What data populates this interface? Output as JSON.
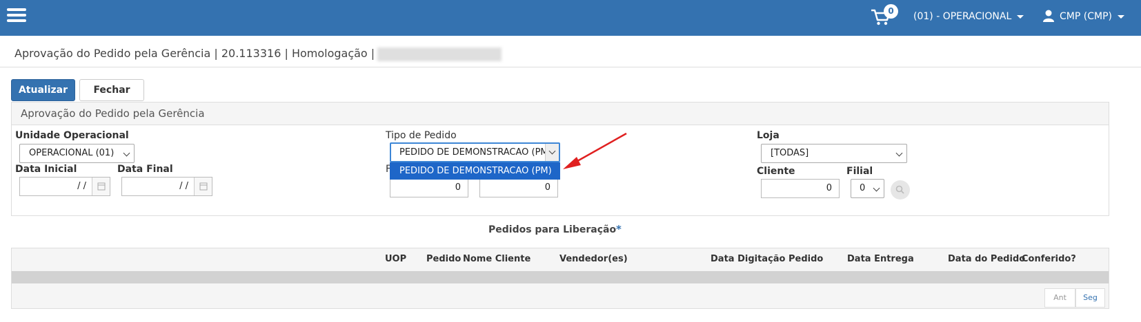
{
  "header": {
    "cart_count": "0",
    "unit_menu": "(01) - OPERACIONAL",
    "user_menu": "CMP (CMP)"
  },
  "breadcrumb": "Aprovação do Pedido pela Gerência | 20.113316 | Homologação |",
  "toolbar": {
    "refresh_label": "Atualizar",
    "close_label": "Fechar"
  },
  "filters": {
    "panel_title": "Aprovação do Pedido pela Gerência",
    "unidade_label": "Unidade Operacional",
    "unidade_value": "OPERACIONAL (01)",
    "data_inicial_label": "Data Inicial",
    "data_inicial_value": "/ /",
    "data_final_label": "Data Final",
    "data_final_value": "/ /",
    "tipo_label": "Tipo de Pedido",
    "tipo_value": "PEDIDO DE DEMONSTRACAO (PM)",
    "tipo_option": "PEDIDO DE DEMONSTRACAO (PM)",
    "hidden_label_fragment": "F",
    "num_from": "0",
    "num_to": "0",
    "loja_label": "Loja",
    "loja_value": "[TODAS]",
    "cliente_label": "Cliente",
    "cliente_value": "0",
    "filial_label": "Filial",
    "filial_value": "0"
  },
  "orders": {
    "title": "Pedidos para Liberação",
    "required_mark": "*",
    "columns": [
      "UOP",
      "Pedido",
      "Nome Cliente",
      "Vendedor(es)",
      "Data Digitação Pedido",
      "Data Entrega",
      "Data do Pedido",
      "Conferido?"
    ],
    "pager_prev": "Ant",
    "pager_next": "Seg"
  },
  "colors": {
    "brand": "#3472b0",
    "selected_option": "#1e66c8",
    "annotation_arrow": "#e02020"
  }
}
